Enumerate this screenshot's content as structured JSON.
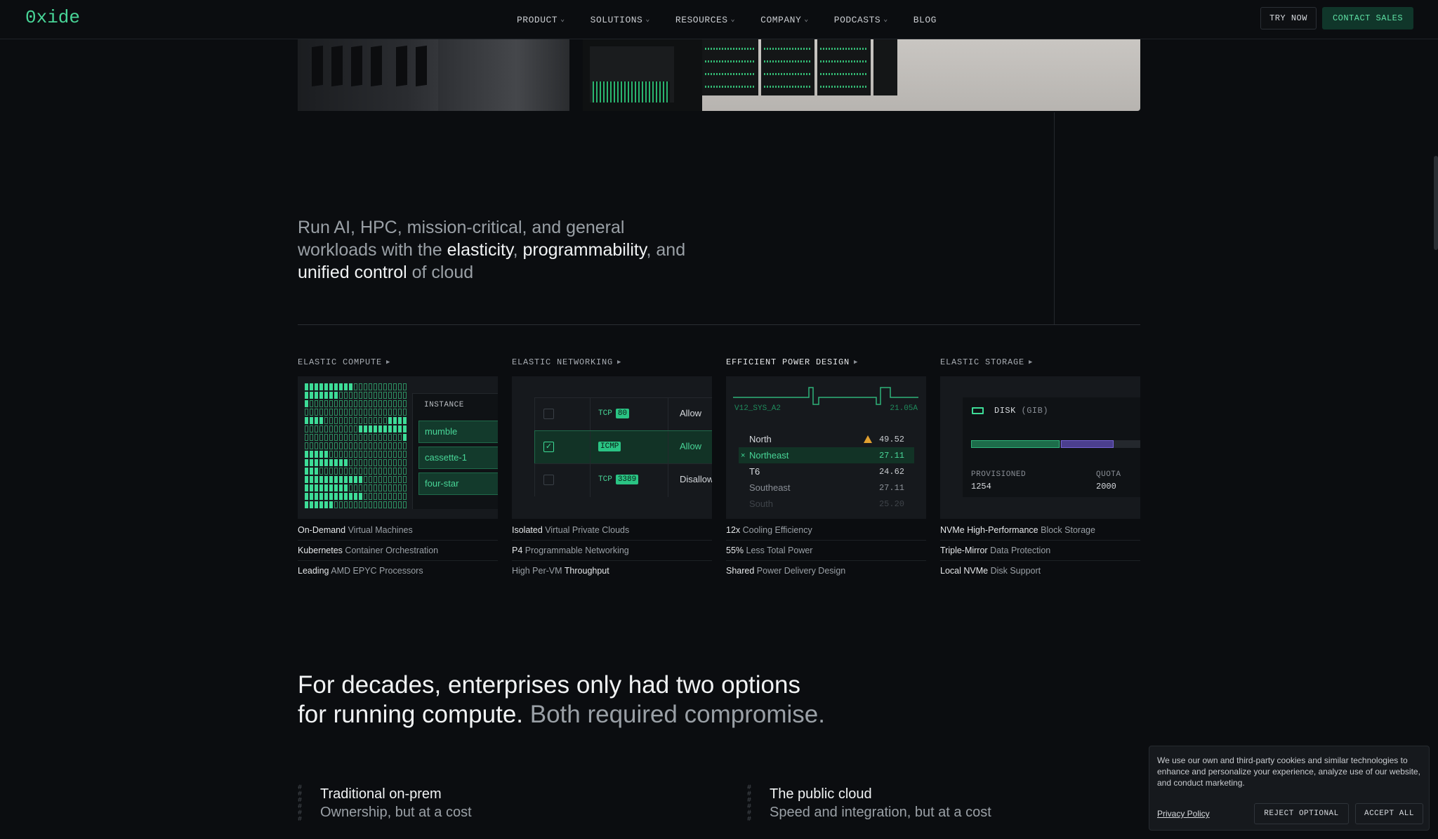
{
  "nav": {
    "logo": "0xide",
    "links": [
      {
        "label": "PRODUCT",
        "dropdown": true
      },
      {
        "label": "SOLUTIONS",
        "dropdown": true
      },
      {
        "label": "RESOURCES",
        "dropdown": true
      },
      {
        "label": "COMPANY",
        "dropdown": true
      },
      {
        "label": "PODCASTS",
        "dropdown": true
      },
      {
        "label": "BLOG",
        "dropdown": false
      }
    ],
    "try_now": "TRY NOW",
    "contact_sales": "CONTACT SALES"
  },
  "hero": {
    "line1_a": "Run AI, HPC, mission-critical, and general",
    "line2_a": "workloads with the ",
    "elasticity": "elasticity",
    "comma1": ", ",
    "programmability": "programmability",
    "and": ", and",
    "unified": "unified control",
    "of_cloud": " of cloud"
  },
  "features": {
    "compute": {
      "title": "ELASTIC COMPUTE",
      "instance_label": "INSTANCE",
      "instances": [
        "mumble",
        "cassette-1",
        "four-star"
      ],
      "items": [
        {
          "strong": "On-Demand",
          "rest": " Virtual Machines"
        },
        {
          "strong": "Kubernetes",
          "rest": " Container Orchestration"
        },
        {
          "strong": "Leading",
          "rest": " AMD EPYC Processors"
        }
      ]
    },
    "networking": {
      "title": "ELASTIC NETWORKING",
      "rules": [
        {
          "proto": "TCP",
          "port": "80",
          "action": "Allow",
          "checked": false
        },
        {
          "proto": "",
          "port": "ICMP",
          "action": "Allow",
          "checked": true
        },
        {
          "proto": "TCP",
          "port": "3389",
          "action": "Disallow",
          "checked": false
        }
      ],
      "items": [
        {
          "strong": "Isolated",
          "rest": " Virtual Private Clouds",
          "strong_first": true
        },
        {
          "strong": "P4",
          "rest": " Programmable Networking",
          "strong_first": true
        },
        {
          "pre": "High Per-VM ",
          "strong": "Throughput",
          "strong_first": false
        }
      ]
    },
    "power": {
      "title": "EFFICIENT POWER DESIGN",
      "sensor": "V12_SYS_A2",
      "reading": "21.05A",
      "rows": [
        {
          "name": "North",
          "value": "49.52",
          "warn": true
        },
        {
          "name": "Northeast",
          "value": "27.11",
          "selected": true
        },
        {
          "name": "T6",
          "value": "24.62"
        },
        {
          "name": "Southeast",
          "value": "27.11"
        },
        {
          "name": "South",
          "value": "25.20"
        }
      ],
      "items": [
        {
          "strong": "12x",
          "rest": " Cooling Efficiency"
        },
        {
          "strong": "55%",
          "rest": " Less Total Power"
        },
        {
          "strong": "Shared",
          "rest": " Power Delivery Design"
        }
      ]
    },
    "storage": {
      "title": "ELASTIC STORAGE",
      "disk_label": "DISK",
      "disk_unit": "(GIB)",
      "provisioned_label": "PROVISIONED",
      "provisioned_value": "1254",
      "quota_label": "QUOTA",
      "quota_value": "2000",
      "items": [
        {
          "strong": "NVMe High-Performance",
          "rest": " Block Storage"
        },
        {
          "strong": "Triple-Mirror",
          "rest": " Data Protection"
        },
        {
          "strong": "Local NVMe",
          "rest": " Disk Support"
        }
      ]
    }
  },
  "section2": {
    "line1": "For decades, enterprises only had two options",
    "line2": "for running compute. ",
    "line2_dim": "Both required compromise.",
    "options": [
      {
        "title": "Traditional on-prem",
        "subtitle": "Ownership, but at a cost"
      },
      {
        "title": "The public cloud",
        "subtitle": "Speed and integration, but at a cost"
      }
    ]
  },
  "cookies": {
    "text": "We use our own and third-party cookies and similar technologies to enhance and personalize your experience, analyze use of our website, and conduct marketing.",
    "privacy": "Privacy Policy",
    "reject": "REJECT OPTIONAL",
    "accept": "ACCEPT ALL"
  },
  "colors": {
    "accent": "#48d597",
    "background": "#0b0d10",
    "quota_purple": "#7563d4"
  }
}
